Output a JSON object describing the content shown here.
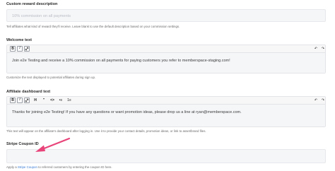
{
  "custom_reward": {
    "label": "Custom reward description",
    "placeholder": "10% commission on all payments",
    "help": "Tell affiliates what kind of reward they'll receive. Leave blank to use the default description based on your commission settings."
  },
  "welcome": {
    "label": "Welcome text",
    "toolbar": {
      "bold": "B",
      "italic": "I",
      "link": "🔗",
      "undo": "↶",
      "redo": "↷"
    },
    "text": "Join e2e Testing and receive a 10% commission on all payments for paying customers you refer to memberspace-staging.com!",
    "help": "Customize the text displayed to potential affiliates during sign up."
  },
  "dashboard": {
    "label": "Affiliate dashboard text",
    "toolbar": {
      "bold": "B",
      "italic": "I",
      "link": "🔗",
      "h1": "H",
      "quote": "”",
      "code": "<>",
      "bullets": "•≡",
      "numbers": "1≡",
      "undo": "↶",
      "redo": "↷"
    },
    "text": "Thanks for joining e2e Testing! If you have any questions or want promotion ideas, please drop us a line at ryan@memberspace.com.",
    "help": "This text will appear on the affiliate's dashboard after logging in. Use it to provide your contact details, promotion ideas, or link to asset/brand files."
  },
  "stripe_coupon": {
    "label": "Stripe Coupon ID",
    "help_prefix": "Apply a ",
    "help_link": "Stripe Coupon",
    "help_suffix": " to referred customers by entering the coupon ID here."
  },
  "colors": {
    "accent": "#3a7bd5",
    "arrow": "#e8447a"
  }
}
